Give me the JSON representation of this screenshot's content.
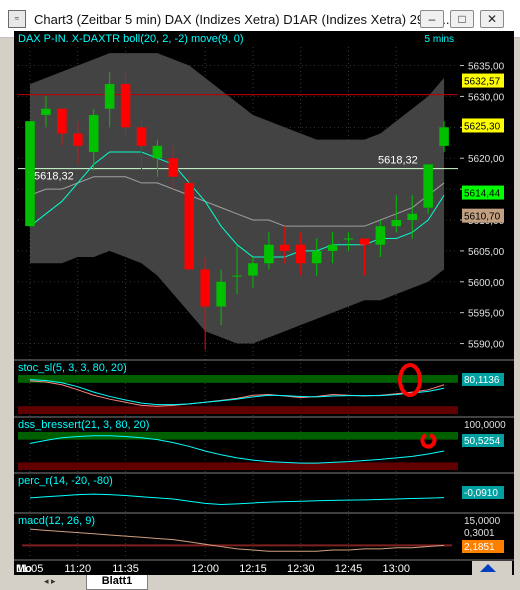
{
  "window": {
    "title": "Chart3 (Zeitbar 5 min)  DAX (Indizes Xetra) D1AR (Indizes Xetra) 29.08....",
    "icon_label": "≈",
    "buttons": {
      "minimize": "–",
      "maximize": "□",
      "close": "✕"
    }
  },
  "main_panel": {
    "header": "DAX P-IN.  X-DAXTR boll(20, 2, -2) move(9, 0)",
    "timeframe": "5 mins",
    "price_ticks": [
      "5635,00",
      "5630,00",
      "5625,00",
      "5620,00",
      "5615,00",
      "5610,00",
      "5605,00",
      "5600,00",
      "5595,00",
      "5590,00"
    ],
    "price_min": 5587.5,
    "price_max": 5638,
    "level_label": "5618,32",
    "level_value": 5618.32,
    "resistance_value": 5630.3,
    "value_labels": [
      {
        "text": "5632,57",
        "value": 5632.57,
        "bg": "#ffff00",
        "fg": "#000000"
      },
      {
        "text": "5625,30",
        "value": 5625.3,
        "bg": "#ffff00",
        "fg": "#000000"
      },
      {
        "text": "5614,44",
        "value": 5614.44,
        "bg": "#00ff00",
        "fg": "#000000"
      },
      {
        "text": "5610,70",
        "value": 5610.7,
        "bg": "#c0a080",
        "fg": "#000000"
      }
    ],
    "candles": [
      {
        "o": 5609,
        "h": 5626,
        "l": 5609,
        "c": 5626
      },
      {
        "o": 5627,
        "h": 5630,
        "l": 5625,
        "c": 5628
      },
      {
        "o": 5628,
        "h": 5628,
        "l": 5622,
        "c": 5624
      },
      {
        "o": 5624,
        "h": 5626,
        "l": 5619,
        "c": 5622
      },
      {
        "o": 5621,
        "h": 5628,
        "l": 5618,
        "c": 5627
      },
      {
        "o": 5628,
        "h": 5634,
        "l": 5625,
        "c": 5632
      },
      {
        "o": 5632,
        "h": 5634,
        "l": 5624,
        "c": 5625
      },
      {
        "o": 5625,
        "h": 5626,
        "l": 5618,
        "c": 5622
      },
      {
        "o": 5620,
        "h": 5623,
        "l": 5617,
        "c": 5622
      },
      {
        "o": 5620,
        "h": 5622,
        "l": 5615,
        "c": 5617
      },
      {
        "o": 5616,
        "h": 5617,
        "l": 5603,
        "c": 5602
      },
      {
        "o": 5602,
        "h": 5604,
        "l": 5589,
        "c": 5596
      },
      {
        "o": 5596,
        "h": 5602,
        "l": 5593,
        "c": 5600
      },
      {
        "o": 5601,
        "h": 5606,
        "l": 5598,
        "c": 5601
      },
      {
        "o": 5601,
        "h": 5604,
        "l": 5599,
        "c": 5603
      },
      {
        "o": 5603,
        "h": 5608,
        "l": 5602,
        "c": 5606
      },
      {
        "o": 5606,
        "h": 5609,
        "l": 5603,
        "c": 5605
      },
      {
        "o": 5606,
        "h": 5608,
        "l": 5601,
        "c": 5603
      },
      {
        "o": 5603,
        "h": 5607,
        "l": 5601,
        "c": 5605
      },
      {
        "o": 5605,
        "h": 5608,
        "l": 5603,
        "c": 5606
      },
      {
        "o": 5607,
        "h": 5608,
        "l": 5605,
        "c": 5607
      },
      {
        "o": 5607,
        "h": 5607,
        "l": 5601,
        "c": 5606
      },
      {
        "o": 5606,
        "h": 5610,
        "l": 5604,
        "c": 5609
      },
      {
        "o": 5609,
        "h": 5614,
        "l": 5608,
        "c": 5610
      },
      {
        "o": 5610,
        "h": 5614,
        "l": 5607,
        "c": 5611
      },
      {
        "o": 5612,
        "h": 5619,
        "l": 5611,
        "c": 5619
      },
      {
        "o": 5622,
        "h": 5626,
        "l": 5621,
        "c": 5625
      }
    ],
    "bb_upper": [
      5632,
      5633,
      5634,
      5635,
      5636,
      5637,
      5637,
      5637,
      5637,
      5636,
      5635,
      5633,
      5631,
      5629,
      5627,
      5626,
      5625,
      5624,
      5623,
      5623,
      5623,
      5623,
      5624,
      5626,
      5628,
      5630,
      5633
    ],
    "bb_lower": [
      5603,
      5603,
      5603,
      5604,
      5604,
      5605,
      5604,
      5603,
      5601,
      5598,
      5595,
      5592,
      5591,
      5590,
      5590,
      5591,
      5592,
      5593,
      5594,
      5595,
      5596,
      5597,
      5597,
      5598,
      5599,
      5600,
      5602
    ],
    "sma_mid": [
      5614,
      5615,
      5615,
      5616,
      5617,
      5617,
      5617,
      5616,
      5616,
      5615,
      5614,
      5613,
      5612,
      5611,
      5610,
      5610,
      5609,
      5609,
      5609,
      5609,
      5609,
      5609,
      5610,
      5611,
      5612,
      5614,
      5616
    ],
    "ma_move": [
      5609,
      5611,
      5613,
      5616,
      5619,
      5621,
      5621,
      5621,
      5620,
      5619,
      5616,
      5613,
      5609,
      5606,
      5604,
      5604,
      5604,
      5605,
      5605,
      5606,
      5606,
      5606,
      5607,
      5607,
      5608,
      5610,
      5614
    ]
  },
  "subpanels": [
    {
      "label": "stoc_sl(5, 3, 3, 80, 20)",
      "value": "80,1136",
      "line1": [
        85,
        82,
        75,
        62,
        48,
        38,
        30,
        22,
        20,
        22,
        26,
        30,
        35,
        40,
        48,
        50,
        46,
        42,
        45,
        50,
        48,
        46,
        48,
        52,
        56,
        62,
        75
      ],
      "line2": [
        88,
        86,
        80,
        70,
        56,
        45,
        36,
        28,
        24,
        24,
        26,
        30,
        34,
        38,
        44,
        48,
        47,
        45,
        44,
        46,
        47,
        47,
        47,
        50,
        54,
        58,
        66
      ]
    },
    {
      "label": "dss_bressert(21, 3, 80, 20)",
      "value_top": "100,0000",
      "value": "50,5254",
      "line1": [
        70,
        78,
        85,
        88,
        90,
        90,
        88,
        85,
        80,
        72,
        62,
        50,
        40,
        32,
        26,
        22,
        20,
        18,
        18,
        20,
        22,
        25,
        28,
        32,
        36,
        42,
        50
      ]
    },
    {
      "label": "perc_r(14, -20, -80)",
      "value": "-0,0910",
      "line1": [
        -45,
        -40,
        -35,
        -30,
        -28,
        -30,
        -34,
        -40,
        -45,
        -50,
        -60,
        -70,
        -75,
        -72,
        -68,
        -64,
        -62,
        -60,
        -58,
        -56,
        -55,
        -54,
        -52,
        -50,
        -48,
        -46,
        -44
      ]
    },
    {
      "label": "macd(12, 26, 9)",
      "value_top": "15,0000",
      "value_small": "0,3001",
      "value": "2,1851",
      "line1": [
        14,
        13,
        12,
        11,
        10,
        9,
        8,
        7,
        6,
        5,
        3,
        1,
        -1,
        -3,
        -4,
        -5,
        -5,
        -5,
        -5,
        -4,
        -4,
        -3,
        -3,
        -2,
        -2,
        -1,
        0
      ]
    }
  ],
  "time_axis": {
    "corner_label": "Mo",
    "labels": [
      "11:05",
      "11:20",
      "11:35",
      "12:00",
      "12:15",
      "12:30",
      "12:45",
      "13:00"
    ],
    "label_bar_index": [
      0,
      3,
      6,
      11,
      14,
      17,
      20,
      23
    ]
  },
  "sheet_tab": {
    "label": "Blatt1",
    "nav": "◂ ▸"
  },
  "colors": {
    "bull": "#00c000",
    "bear": "#ff0000",
    "band_fill": "#4a4a4a",
    "sma": "#a0a0a0",
    "move": "#00ffcc",
    "level": "#d0ffd0",
    "resistance": "#c00000",
    "stoch_1": "#ff8080",
    "stoch_2": "#00ffff",
    "zone_top": "#006000",
    "zone_bottom": "#600000"
  }
}
